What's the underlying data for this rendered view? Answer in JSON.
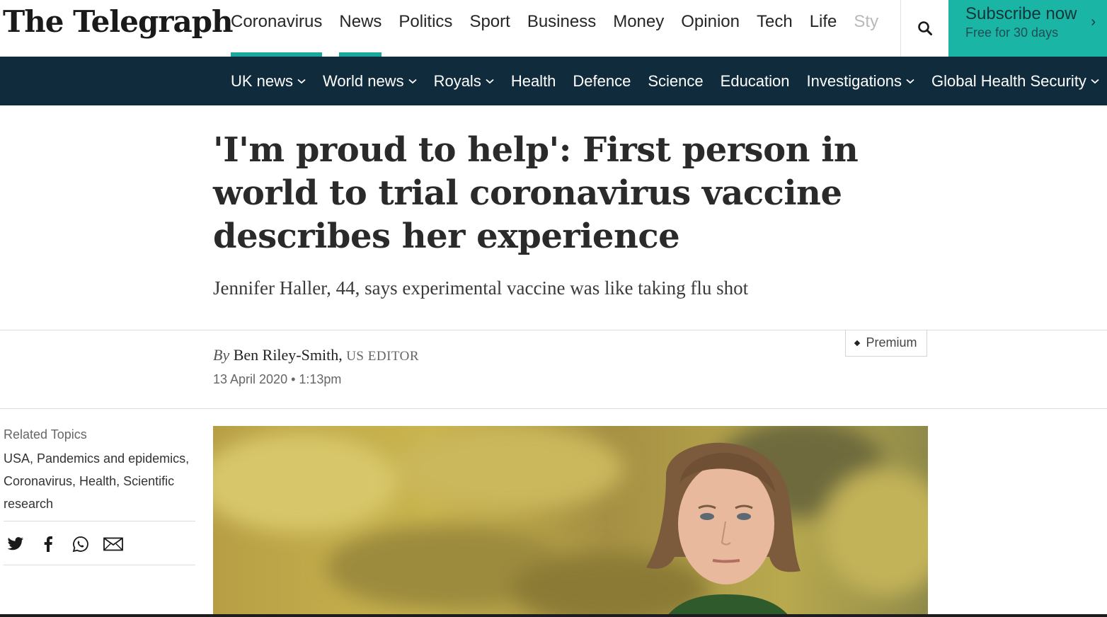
{
  "header": {
    "logo": "The Telegraph",
    "nav": [
      {
        "label": "Coronavirus",
        "active": true
      },
      {
        "label": "News",
        "active": true
      },
      {
        "label": "Politics"
      },
      {
        "label": "Sport"
      },
      {
        "label": "Business"
      },
      {
        "label": "Money"
      },
      {
        "label": "Opinion"
      },
      {
        "label": "Tech"
      },
      {
        "label": "Life"
      },
      {
        "label": "Sty"
      }
    ],
    "search_icon": "search-icon",
    "subscribe": {
      "title": "Subscribe now",
      "subtitle": "Free for 30 days"
    },
    "accent_color": "#1ab5a5"
  },
  "section_nav": {
    "background": "#0f2b3c",
    "items": [
      {
        "label": "UK news",
        "dropdown": true
      },
      {
        "label": "World news",
        "dropdown": true
      },
      {
        "label": "Royals",
        "dropdown": true
      },
      {
        "label": "Health",
        "dropdown": false
      },
      {
        "label": "Defence",
        "dropdown": false
      },
      {
        "label": "Science",
        "dropdown": false
      },
      {
        "label": "Education",
        "dropdown": false
      },
      {
        "label": "Investigations",
        "dropdown": true
      },
      {
        "label": "Global Health Security",
        "dropdown": true
      }
    ]
  },
  "article": {
    "headline": "'I'm proud to help': First person in world to trial coronavirus vaccine describes her experience",
    "standfirst": "Jennifer Haller, 44, says experimental vaccine was like taking flu shot",
    "byline_prefix": "By",
    "author": "Ben Riley-Smith,",
    "role": "US EDITOR",
    "date": "13 April 2020 • 1:13pm",
    "badge": "Premium"
  },
  "sidebar": {
    "related_label": "Related Topics",
    "related_topics": "USA, Pandemics and epidemics, Coronavirus, Health, Scientific research",
    "share_icons": [
      "twitter-icon",
      "facebook-icon",
      "whatsapp-icon",
      "email-icon"
    ]
  }
}
